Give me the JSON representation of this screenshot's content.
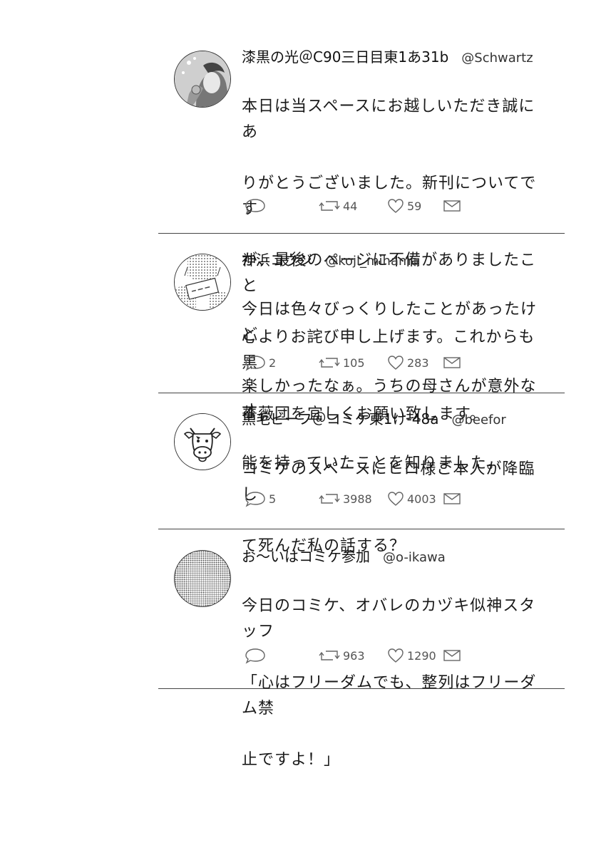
{
  "tweets": [
    {
      "name": "漆黒の光＠C90三日目東1あ31b",
      "handle": "@Schwartz",
      "text": "本日は当スペースにお越しいただき誠にありがとうございました。新刊についてですが、最後のページに不備がありましたこと心よりお詫び申し上げます。これからも黒薔薇団を宜しくお願い致します。",
      "lines": [
        "本日は当スペースにお越しいただき誠にあ",
        "りがとうございました。新刊についてです",
        "が、最後のページに不備がありましたこと",
        "心よりお詫び申し上げます。これからも黒",
        "薔薇団を宜しくお願い致します。"
      ],
      "reply_count": "",
      "retweet_count": "44",
      "like_count": "59",
      "avatar_icon": "character-portrait-icon"
    },
    {
      "name": "神浜コウジ",
      "handle": "@koji_mihama",
      "lines": [
        "今日は色々びっくりしたことがあったけど",
        "楽しかったなぁ。うちの母さんが意外な才",
        "能を持っていたことを知りました。"
      ],
      "reply_count": "2",
      "retweet_count": "105",
      "like_count": "283",
      "avatar_icon": "character-with-sign-icon"
    },
    {
      "name": "黒毛ビーフ＠コミケ東1け-48a",
      "handle": "@beefor",
      "lines": [
        "コミケのスペースにヒロ様ご本人が降臨し",
        "て死んだ私の話する？"
      ],
      "reply_count": "5",
      "retweet_count": "3988",
      "like_count": "4003",
      "avatar_icon": "cow-face-icon"
    },
    {
      "name": "お～いはコミケ参加",
      "handle": "@o-ikawa",
      "lines": [
        "今日のコミケ、オバレのカヅキ似神スタッフ",
        "「心はフリーダムでも、整列はフリーダム禁",
        "止ですよ！」"
      ],
      "reply_count": "",
      "retweet_count": "963",
      "like_count": "1290",
      "avatar_icon": "blurred-figure-icon"
    }
  ],
  "icons": {
    "reply": "reply-bubble-icon",
    "retweet": "retweet-icon",
    "like": "heart-icon",
    "message": "envelope-icon"
  }
}
